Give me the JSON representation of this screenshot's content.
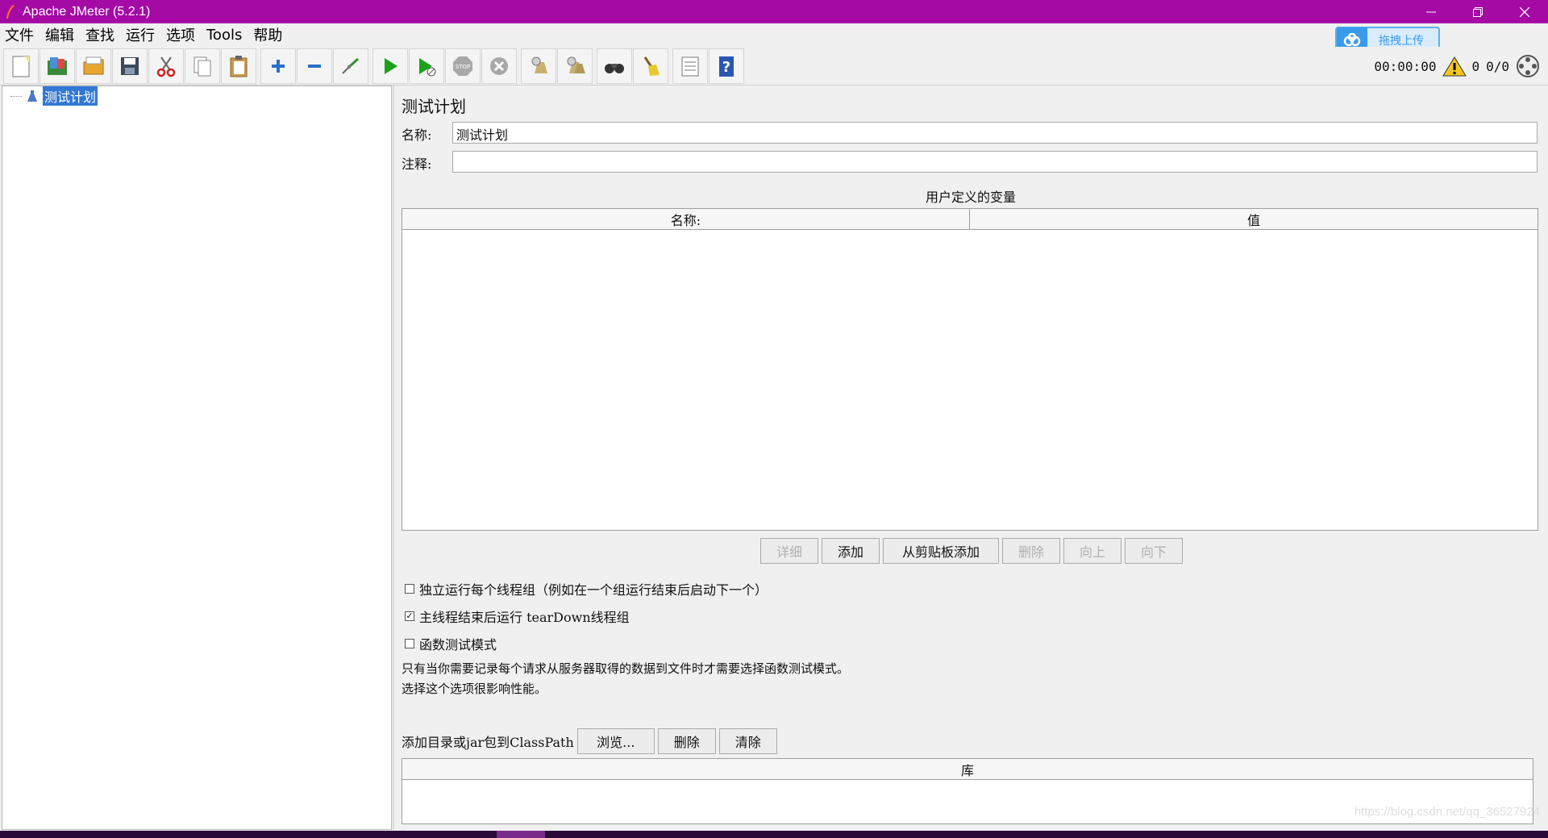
{
  "window": {
    "title": "Apache JMeter (5.2.1)"
  },
  "menu": {
    "items": [
      "文件",
      "编辑",
      "查找",
      "运行",
      "选项",
      "Tools",
      "帮助"
    ]
  },
  "upload_badge": {
    "label": "拖拽上传"
  },
  "toolbar": {
    "icons": [
      "new-icon",
      "templates-icon",
      "open-icon",
      "save-icon",
      "cut-icon",
      "copy-icon",
      "paste-icon",
      "expand-icon",
      "collapse-icon",
      "toggle-icon",
      "start-icon",
      "start-no-pause-icon",
      "stop-icon",
      "shutdown-icon",
      "clear-icon",
      "clear-all-icon",
      "search-icon",
      "reset-search-icon",
      "function-helper-icon",
      "help-icon"
    ],
    "timer": "00:00:00",
    "warning_count": "0",
    "threads": "0/0"
  },
  "tree": {
    "root_label": "测试计划"
  },
  "plan": {
    "title": "测试计划",
    "name_label": "名称:",
    "name_value": "测试计划",
    "comment_label": "注释:",
    "comment_value": "",
    "variables_title": "用户定义的变量",
    "variables_columns": [
      "名称:",
      "值"
    ],
    "buttons": {
      "detail": "详细",
      "add": "添加",
      "add_from_clipboard": "从剪贴板添加",
      "delete": "删除",
      "up": "向上",
      "down": "向下"
    },
    "options": {
      "independent_threads": "独立运行每个线程组（例如在一个组运行结束后启动下一个）",
      "teardown_after_shutdown": "主线程结束后运行 tearDown线程组",
      "functional_mode": "函数测试模式"
    },
    "note_line1": "只有当你需要记录每个请求从服务器取得的数据到文件时才需要选择函数测试模式。",
    "note_line2": "选择这个选项很影响性能。",
    "classpath": {
      "label": "添加目录或jar包到ClassPath",
      "browse": "浏览...",
      "delete": "删除",
      "clear": "清除",
      "library_column": "库"
    }
  },
  "watermark": "https://blog.csdn.net/qq_36527924"
}
